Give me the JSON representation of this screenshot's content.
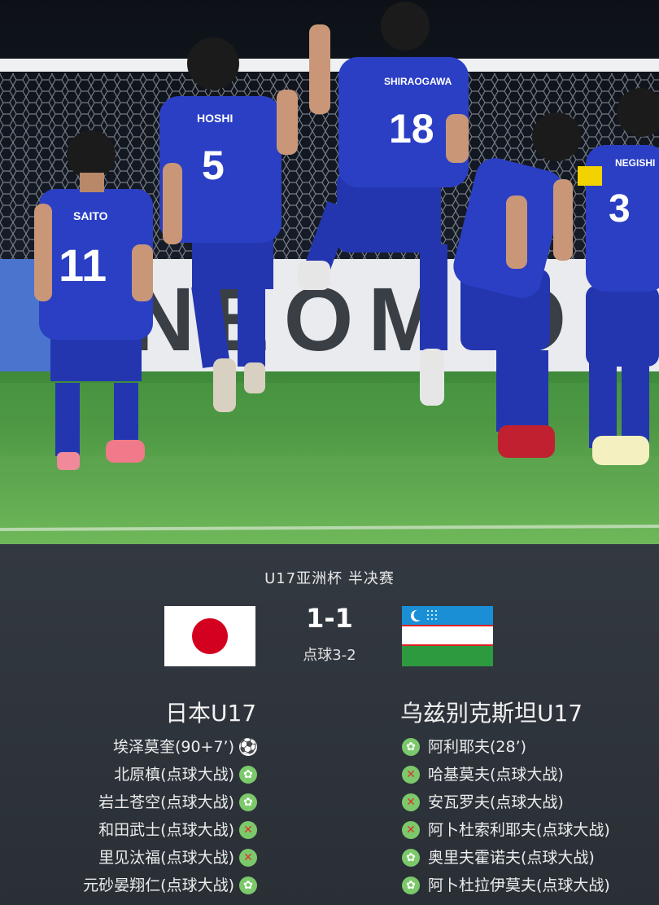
{
  "photo": {
    "jersey_names": [
      "SAITO",
      "HOSHI",
      "SHIRAOGAWA",
      "NEGISHI"
    ],
    "jersey_numbers": [
      "11",
      "5",
      "18",
      "3"
    ],
    "board_text": "NEOM O"
  },
  "match": {
    "competition": "U17亚洲杯 半决赛",
    "score": "1-1",
    "penalties": "点球3-2",
    "home": {
      "name": "日本U17",
      "flag": "japan-flag",
      "events": [
        {
          "text": "埃泽莫奎(90+7’)",
          "icon": "ball-icon"
        },
        {
          "text": "北原槙(点球大战)",
          "icon": "penalty-scored-icon"
        },
        {
          "text": "岩土苍空(点球大战)",
          "icon": "penalty-scored-icon"
        },
        {
          "text": "和田武士(点球大战)",
          "icon": "penalty-missed-icon"
        },
        {
          "text": "里见汰福(点球大战)",
          "icon": "penalty-missed-icon"
        },
        {
          "text": "元砂晏翔仁(点球大战)",
          "icon": "penalty-scored-icon"
        }
      ]
    },
    "away": {
      "name": "乌兹别克斯坦U17",
      "flag": "uzbekistan-flag",
      "events": [
        {
          "text": "阿利耶夫(28’)",
          "icon": "goal-icon"
        },
        {
          "text": "哈基莫夫(点球大战)",
          "icon": "penalty-missed-icon"
        },
        {
          "text": "安瓦罗夫(点球大战)",
          "icon": "penalty-missed-icon"
        },
        {
          "text": "阿卜杜索利耶夫(点球大战)",
          "icon": "penalty-missed-icon"
        },
        {
          "text": "奥里夫霍诺夫(点球大战)",
          "icon": "penalty-scored-icon"
        },
        {
          "text": "阿卜杜拉伊莫夫(点球大战)",
          "icon": "penalty-scored-icon"
        }
      ]
    }
  },
  "colors": {
    "panel_bg": "#2f343b",
    "jersey": "#2a3fc4",
    "pitch": "#5aa84a",
    "icon_green": "#7bc96b",
    "miss_red": "#e0332e"
  }
}
